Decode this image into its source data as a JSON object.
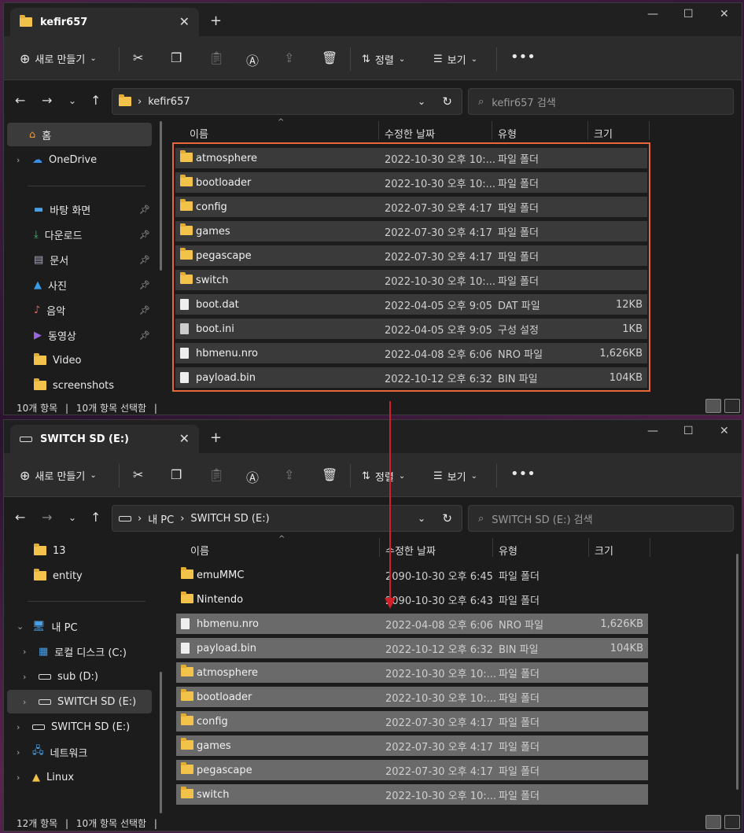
{
  "top": {
    "tab_title": "kefir657",
    "new_label": "새로 만들기",
    "sort_label": "정렬",
    "view_label": "보기",
    "breadcrumb": [
      "kefir657"
    ],
    "search_placeholder": "kefir657 검색",
    "headers": {
      "name": "이름",
      "date": "수정한 날짜",
      "type": "유형",
      "size": "크기"
    },
    "sidebar": {
      "home": "홈",
      "onedrive": "OneDrive",
      "desktop": "바탕 화면",
      "downloads": "다운로드",
      "documents": "문서",
      "pictures": "사진",
      "music": "음악",
      "videos": "동영상",
      "video": "Video",
      "screenshots": "screenshots"
    },
    "rows": [
      {
        "name": "atmosphere",
        "date": "2022-10-30 오후 10:...",
        "type": "파일 폴더",
        "size": "",
        "icon": "folder"
      },
      {
        "name": "bootloader",
        "date": "2022-10-30 오후 10:...",
        "type": "파일 폴더",
        "size": "",
        "icon": "folder"
      },
      {
        "name": "config",
        "date": "2022-07-30 오후 4:17",
        "type": "파일 폴더",
        "size": "",
        "icon": "folder"
      },
      {
        "name": "games",
        "date": "2022-07-30 오후 4:17",
        "type": "파일 폴더",
        "size": "",
        "icon": "folder"
      },
      {
        "name": "pegascape",
        "date": "2022-07-30 오후 4:17",
        "type": "파일 폴더",
        "size": "",
        "icon": "folder"
      },
      {
        "name": "switch",
        "date": "2022-10-30 오후 10:...",
        "type": "파일 폴더",
        "size": "",
        "icon": "folder"
      },
      {
        "name": "boot.dat",
        "date": "2022-04-05 오후 9:05",
        "type": "DAT 파일",
        "size": "12KB",
        "icon": "file"
      },
      {
        "name": "boot.ini",
        "date": "2022-04-05 오후 9:05",
        "type": "구성 설정",
        "size": "1KB",
        "icon": "settings-file"
      },
      {
        "name": "hbmenu.nro",
        "date": "2022-04-08 오후 6:06",
        "type": "NRO 파일",
        "size": "1,626KB",
        "icon": "file"
      },
      {
        "name": "payload.bin",
        "date": "2022-10-12 오후 6:32",
        "type": "BIN 파일",
        "size": "104KB",
        "icon": "file"
      }
    ],
    "status_count": "10개 항목",
    "status_selected": "10개 항목 선택함"
  },
  "bottom": {
    "tab_title": "SWITCH SD (E:)",
    "new_label": "새로 만들기",
    "sort_label": "정렬",
    "view_label": "보기",
    "breadcrumb": [
      "내 PC",
      "SWITCH SD (E:)"
    ],
    "search_placeholder": "SWITCH SD (E:) 검색",
    "headers": {
      "name": "이름",
      "date": "수정한 날짜",
      "type": "유형",
      "size": "크기"
    },
    "sidebar": {
      "f13": "13",
      "entity": "entity",
      "mypc": "내 PC",
      "localc": "로컬 디스크 (C:)",
      "subd": "sub (D:)",
      "sde_child": "SWITCH SD (E:)",
      "sde": "SWITCH SD (E:)",
      "network": "네트워크",
      "linux": "Linux"
    },
    "rows": [
      {
        "name": "emuMMC",
        "date": "2090-10-30 오후 6:45",
        "type": "파일 폴더",
        "size": "",
        "icon": "folder",
        "style": ""
      },
      {
        "name": "Nintendo",
        "date": "2090-10-30 오후 6:43",
        "type": "파일 폴더",
        "size": "",
        "icon": "folder",
        "style": ""
      },
      {
        "name": "hbmenu.nro",
        "date": "2022-04-08 오후 6:06",
        "type": "NRO 파일",
        "size": "1,626KB",
        "icon": "file",
        "style": "grey"
      },
      {
        "name": "payload.bin",
        "date": "2022-10-12 오후 6:32",
        "type": "BIN 파일",
        "size": "104KB",
        "icon": "file",
        "style": "grey"
      },
      {
        "name": "atmosphere",
        "date": "2022-10-30 오후 10:...",
        "type": "파일 폴더",
        "size": "",
        "icon": "folder",
        "style": "grey"
      },
      {
        "name": "bootloader",
        "date": "2022-10-30 오후 10:...",
        "type": "파일 폴더",
        "size": "",
        "icon": "folder",
        "style": "grey"
      },
      {
        "name": "config",
        "date": "2022-07-30 오후 4:17",
        "type": "파일 폴더",
        "size": "",
        "icon": "folder",
        "style": "grey"
      },
      {
        "name": "games",
        "date": "2022-07-30 오후 4:17",
        "type": "파일 폴더",
        "size": "",
        "icon": "folder",
        "style": "grey"
      },
      {
        "name": "pegascape",
        "date": "2022-07-30 오후 4:17",
        "type": "파일 폴더",
        "size": "",
        "icon": "folder",
        "style": "grey"
      },
      {
        "name": "switch",
        "date": "2022-10-30 오후 10:...",
        "type": "파일 폴더",
        "size": "",
        "icon": "folder",
        "style": "grey"
      }
    ],
    "status_count": "12개 항목",
    "status_selected": "10개 항목 선택함"
  },
  "colors": {
    "selection_box": "#e8673a",
    "arrow": "#d0202a",
    "folder": "#f3c24a"
  }
}
